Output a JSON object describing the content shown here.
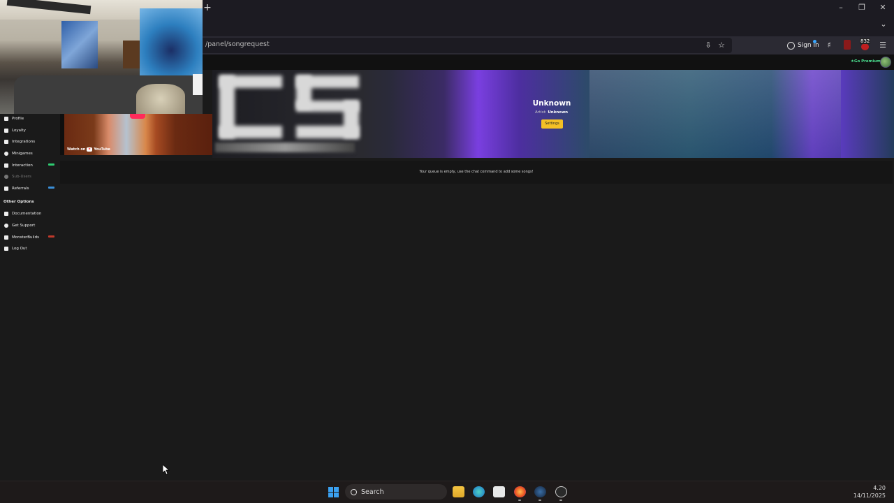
{
  "browser": {
    "url": "/panel/songrequest",
    "sign_in_label": "Sign in",
    "extension_badge": "832"
  },
  "page": {
    "go_premium_label": "Go Premium",
    "now_playing": {
      "title": "Unknown",
      "artist_label": "Artist:",
      "artist_value": "Unknown",
      "settings_button": "Settings"
    },
    "queue_empty_text": "Your queue is empty, use the chat command to add some songs!"
  },
  "sidebar": {
    "items": [
      {
        "label": "Profile",
        "icon": "profile-icon"
      },
      {
        "label": "Loyalty",
        "icon": "trophy-icon"
      },
      {
        "label": "Integrations",
        "icon": "integrations-icon"
      },
      {
        "label": "Minigames",
        "icon": "gamepad-icon"
      },
      {
        "label": "Interaction",
        "icon": "music-icon"
      },
      {
        "label": "Sub-Users",
        "icon": "users-icon"
      },
      {
        "label": "Referrals",
        "icon": "referrals-icon"
      }
    ],
    "other_heading": "Other Options",
    "other_items": [
      {
        "label": "Documentation",
        "icon": "docs-icon"
      },
      {
        "label": "Get Support",
        "icon": "support-icon"
      },
      {
        "label": "MonsterBuilds",
        "icon": "monitor-icon"
      },
      {
        "label": "Log Out",
        "icon": "logout-icon"
      }
    ]
  },
  "youtube_embed": {
    "watch_on_label": "Watch on",
    "brand": "YouTube"
  },
  "taskbar": {
    "search_label": "Search",
    "time": "4.20",
    "date": "14/11/2025"
  },
  "colors": {
    "accent_yellow": "#f4c025",
    "premium_green": "#4be08f",
    "windows_blue": "#3aa0f0"
  }
}
